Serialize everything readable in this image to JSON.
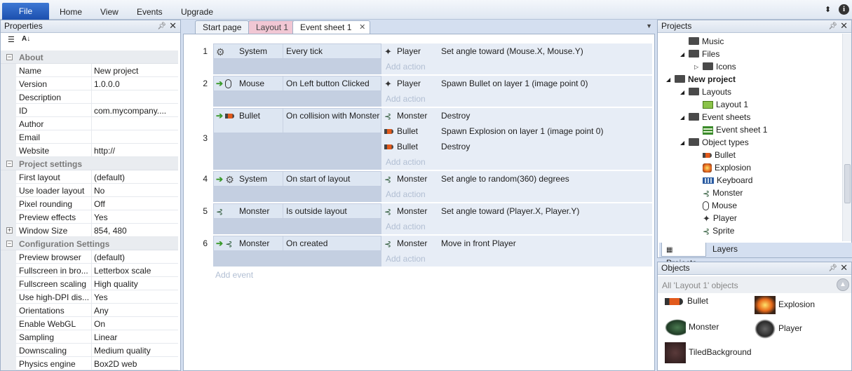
{
  "ribbon": {
    "file_label": "File",
    "menus": [
      "Home",
      "View",
      "Events",
      "Upgrade"
    ]
  },
  "properties": {
    "title": "Properties",
    "categories": [
      {
        "label": "About",
        "rows": [
          {
            "key": "Name",
            "value": "New project"
          },
          {
            "key": "Version",
            "value": "1.0.0.0"
          },
          {
            "key": "Description",
            "value": ""
          },
          {
            "key": "ID",
            "value": "com.mycompany...."
          },
          {
            "key": "Author",
            "value": ""
          },
          {
            "key": "Email",
            "value": ""
          },
          {
            "key": "Website",
            "value": "http://"
          }
        ]
      },
      {
        "label": "Project settings",
        "rows": [
          {
            "key": "First layout",
            "value": "(default)"
          },
          {
            "key": "Use loader layout",
            "value": "No"
          },
          {
            "key": "Pixel rounding",
            "value": "Off"
          },
          {
            "key": "Preview effects",
            "value": "Yes"
          },
          {
            "key": "Window Size",
            "value": "854, 480",
            "expandable": true
          }
        ]
      },
      {
        "label": "Configuration Settings",
        "rows": [
          {
            "key": "Preview browser",
            "value": "(default)"
          },
          {
            "key": "Fullscreen in bro...",
            "value": "Letterbox scale"
          },
          {
            "key": "Fullscreen scaling",
            "value": "High quality"
          },
          {
            "key": "Use high-DPI dis...",
            "value": "Yes"
          },
          {
            "key": "Orientations",
            "value": "Any"
          },
          {
            "key": "Enable WebGL",
            "value": "On"
          },
          {
            "key": "Sampling",
            "value": "Linear"
          },
          {
            "key": "Downscaling",
            "value": "Medium quality"
          },
          {
            "key": "Physics engine",
            "value": "Box2D web"
          }
        ]
      }
    ]
  },
  "tabs": [
    {
      "label": "Start page"
    },
    {
      "label": "Layout 1"
    },
    {
      "label": "Event sheet 1",
      "active": true
    }
  ],
  "events": {
    "add_action_label": "Add action",
    "add_event_label": "Add event",
    "items": [
      {
        "num": "1",
        "cond_obj": "System",
        "cond_text": "Every tick",
        "actions": [
          {
            "obj": "Player",
            "text": "Set angle toward (Mouse.X, Mouse.Y)"
          }
        ]
      },
      {
        "num": "2",
        "cond_obj": "Mouse",
        "cond_text": "On Left button Clicked",
        "actions": [
          {
            "obj": "Player",
            "text": "Spawn Bullet on layer 1 (image point 0)"
          }
        ]
      },
      {
        "num": "3",
        "cond_obj": "Bullet",
        "cond_text": "On collision with Monster",
        "actions": [
          {
            "obj": "Monster",
            "text": "Destroy"
          },
          {
            "obj": "Bullet",
            "text": "Spawn Explosion on layer 1 (image point 0)"
          },
          {
            "obj": "Bullet",
            "text": "Destroy"
          }
        ]
      },
      {
        "num": "4",
        "cond_obj": "System",
        "cond_text": "On start of layout",
        "actions": [
          {
            "obj": "Monster",
            "text": "Set angle to random(360) degrees"
          }
        ]
      },
      {
        "num": "5",
        "cond_obj": "Monster",
        "cond_text": "Is outside layout",
        "actions": [
          {
            "obj": "Monster",
            "text": "Set angle toward (Player.X, Player.Y)"
          }
        ]
      },
      {
        "num": "6",
        "cond_obj": "Monster",
        "cond_text": "On created",
        "actions": [
          {
            "obj": "Monster",
            "text": "Move in front Player"
          }
        ]
      }
    ]
  },
  "projects": {
    "title": "Projects",
    "tree": [
      {
        "label": "Music",
        "bold": false
      },
      {
        "label": "Files",
        "bold": false
      },
      {
        "label": "Icons",
        "bold": false
      },
      {
        "label": "New project",
        "bold": true
      },
      {
        "label": "Layouts",
        "bold": false
      },
      {
        "label": "Layout 1",
        "bold": false
      },
      {
        "label": "Event sheets",
        "bold": false
      },
      {
        "label": "Event sheet 1",
        "bold": false
      },
      {
        "label": "Object types",
        "bold": false
      },
      {
        "label": "Bullet",
        "bold": false
      },
      {
        "label": "Explosion",
        "bold": false
      },
      {
        "label": "Keyboard",
        "bold": false
      },
      {
        "label": "Monster",
        "bold": false
      },
      {
        "label": "Mouse",
        "bold": false
      },
      {
        "label": "Player",
        "bold": false
      },
      {
        "label": "Sprite",
        "bold": false
      }
    ],
    "bottom_tabs": [
      "Projects",
      "Layers"
    ]
  },
  "objects": {
    "title": "Objects",
    "filter": "All 'Layout 1' objects",
    "items": [
      "Bullet",
      "Explosion",
      "Monster",
      "Player",
      "TiledBackground"
    ]
  }
}
